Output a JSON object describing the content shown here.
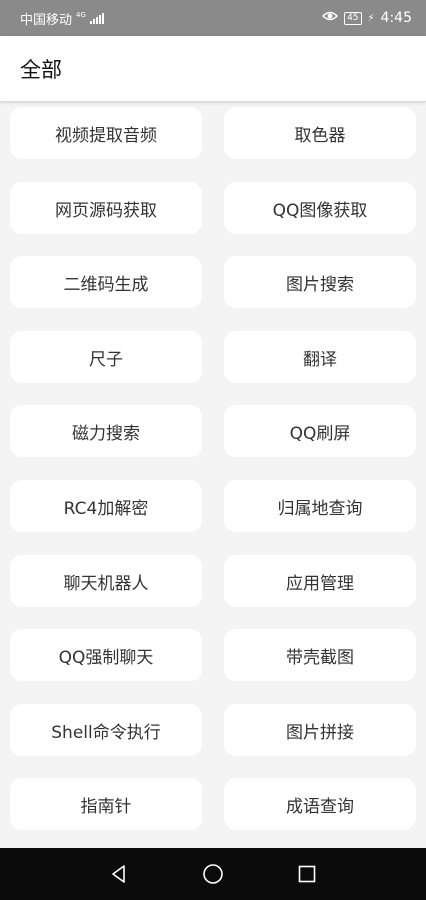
{
  "status_bar": {
    "carrier": "中国移动",
    "network": "4G",
    "battery": "45",
    "time": "4:45"
  },
  "app_bar": {
    "title": "全部"
  },
  "tools": [
    "视频提取音频",
    "取色器",
    "网页源码获取",
    "QQ图像获取",
    "二维码生成",
    "图片搜索",
    "尺子",
    "翻译",
    "磁力搜索",
    "QQ刷屏",
    "RC4加解密",
    "归属地查询",
    "聊天机器人",
    "应用管理",
    "QQ强制聊天",
    "带壳截图",
    "Shell命令执行",
    "图片拼接",
    "指南针",
    "成语查询"
  ],
  "icons": {
    "signal": "signal-icon",
    "eye": "eye-comfort-icon",
    "battery": "battery-icon",
    "charging": "charging-icon",
    "back": "back-icon",
    "home": "home-icon",
    "recents": "recents-icon"
  },
  "colors": {
    "status_bar_bg": "#8a8a8a",
    "app_bar_bg": "#ffffff",
    "page_bg": "#f4f4f4",
    "card_bg": "#ffffff",
    "card_text": "#333333",
    "nav_bar_bg": "#0b0b0b"
  }
}
